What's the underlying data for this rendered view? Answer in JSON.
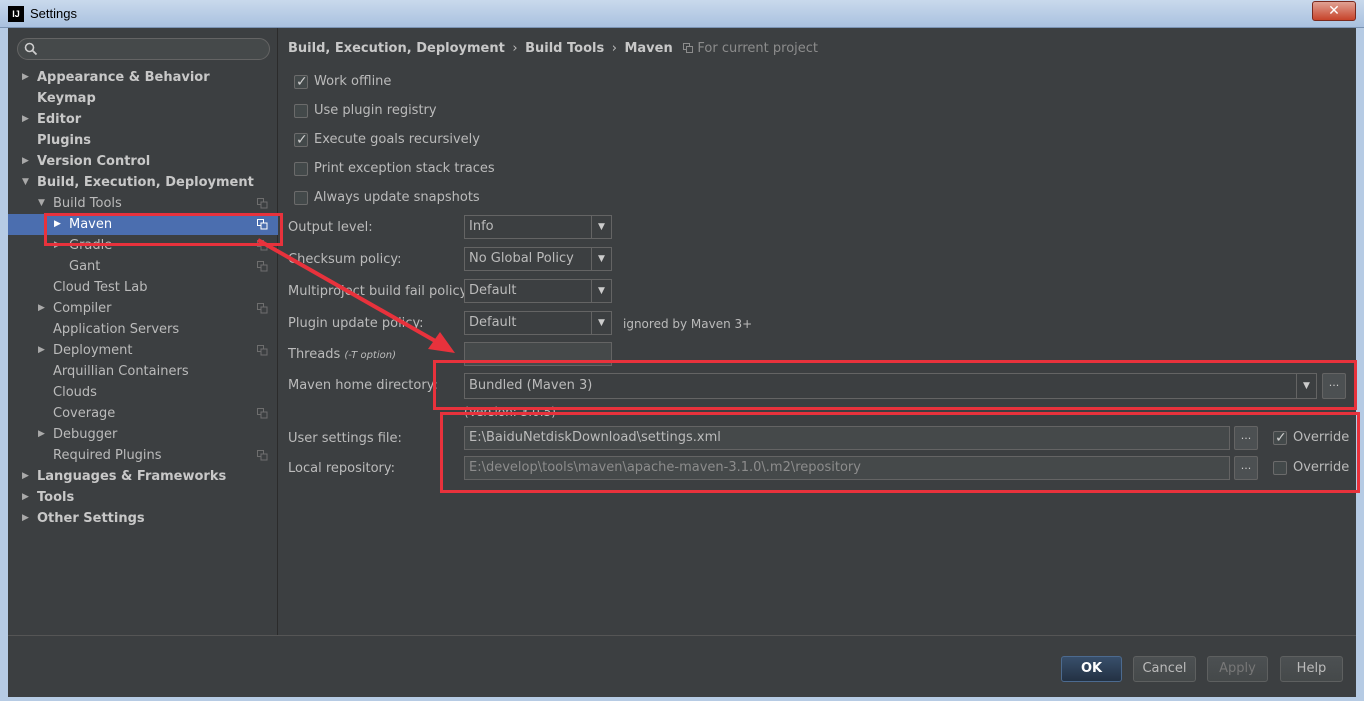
{
  "window": {
    "title": "Settings",
    "app_icon_text": "IJ",
    "close_symbol": "✕"
  },
  "search": {
    "value": "",
    "placeholder": ""
  },
  "tree": [
    {
      "label": "Appearance & Behavior",
      "arrow": "▶",
      "bold": true
    },
    {
      "label": "Keymap",
      "arrow": "",
      "bold": true
    },
    {
      "label": "Editor",
      "arrow": "▶",
      "bold": true
    },
    {
      "label": "Plugins",
      "arrow": "",
      "bold": true
    },
    {
      "label": "Version Control",
      "arrow": "▶",
      "bold": true
    },
    {
      "label": "Build, Execution, Deployment",
      "arrow": "▼",
      "bold": true
    },
    {
      "label": "Build Tools",
      "arrow": "▼",
      "bold": false
    },
    {
      "label": "Maven",
      "arrow": "▶",
      "bold": false,
      "selected": true
    },
    {
      "label": "Gradle",
      "arrow": "▶",
      "bold": false
    },
    {
      "label": "Gant",
      "arrow": "",
      "bold": false
    },
    {
      "label": "Cloud Test Lab",
      "arrow": "",
      "bold": false
    },
    {
      "label": "Compiler",
      "arrow": "▶",
      "bold": false
    },
    {
      "label": "Application Servers",
      "arrow": "",
      "bold": false
    },
    {
      "label": "Deployment",
      "arrow": "▶",
      "bold": false
    },
    {
      "label": "Arquillian Containers",
      "arrow": "",
      "bold": false
    },
    {
      "label": "Clouds",
      "arrow": "",
      "bold": false
    },
    {
      "label": "Coverage",
      "arrow": "",
      "bold": false
    },
    {
      "label": "Debugger",
      "arrow": "▶",
      "bold": false
    },
    {
      "label": "Required Plugins",
      "arrow": "",
      "bold": false
    },
    {
      "label": "Languages & Frameworks",
      "arrow": "▶",
      "bold": true
    },
    {
      "label": "Tools",
      "arrow": "▶",
      "bold": true
    },
    {
      "label": "Other Settings",
      "arrow": "▶",
      "bold": true
    }
  ],
  "breadcrumb": {
    "part1": "Build, Execution, Deployment",
    "sep": "›",
    "part2": "Build Tools",
    "part3": "Maven",
    "note": "For current project"
  },
  "checkboxes": {
    "work_offline": {
      "label": "Work offline",
      "checked": true
    },
    "use_plugin_registry": {
      "label": "Use plugin registry",
      "checked": false
    },
    "execute_goals": {
      "label": "Execute goals recursively",
      "checked": true
    },
    "print_exception": {
      "label": "Print exception stack traces",
      "checked": false
    },
    "always_update": {
      "label": "Always update snapshots",
      "checked": false
    }
  },
  "form": {
    "output_level": {
      "label": "Output level:",
      "value": "Info"
    },
    "checksum_policy": {
      "label": "Checksum policy:",
      "value": "No Global Policy"
    },
    "multiproject_fail": {
      "label": "Multiproject build fail policy:",
      "value": "Default"
    },
    "plugin_update": {
      "label": "Plugin update policy:",
      "value": "Default",
      "note": "ignored by Maven 3+"
    },
    "threads": {
      "label": "Threads",
      "hint": "(-T option)",
      "value": ""
    },
    "maven_home": {
      "label": "Maven home directory:",
      "value": "Bundled (Maven 3)",
      "version": "(Version: 3.0.5)"
    },
    "user_settings": {
      "label": "User settings file:",
      "value": "E:\\BaiduNetdiskDownload\\settings.xml",
      "override_label": "Override",
      "override_checked": true
    },
    "local_repo": {
      "label": "Local repository:",
      "value": "E:\\develop\\tools\\maven\\apache-maven-3.1.0\\.m2\\repository",
      "override_label": "Override",
      "override_checked": false
    },
    "browse_label": "..."
  },
  "buttons": {
    "ok": "OK",
    "cancel": "Cancel",
    "apply": "Apply",
    "help": "Help"
  },
  "colors": {
    "selection": "#4b6eaf",
    "annotation_red": "#e8323c",
    "background": "#3c3f41"
  }
}
